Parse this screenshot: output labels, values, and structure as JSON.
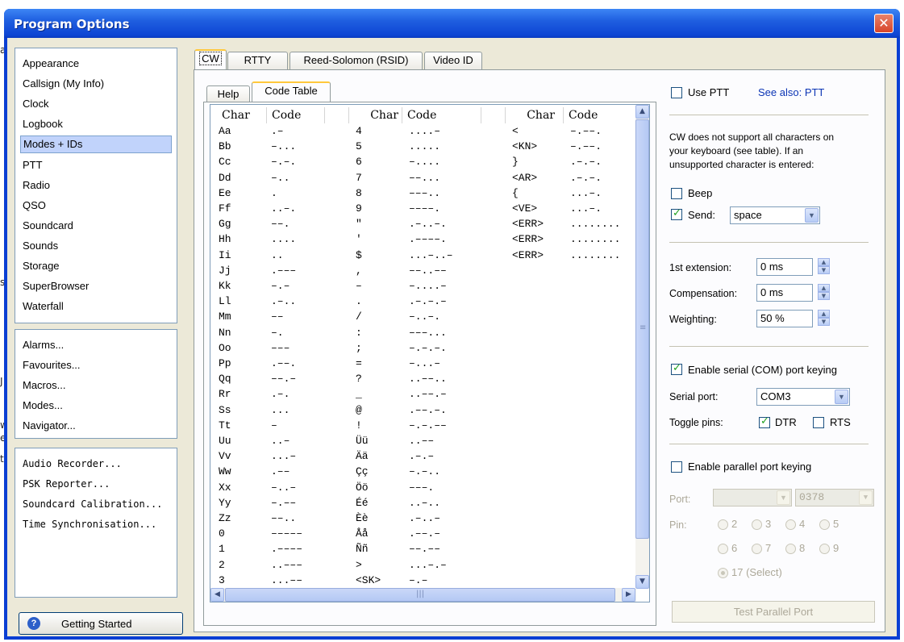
{
  "window": {
    "title": "Program Options",
    "close_glyph": "✕"
  },
  "nav": {
    "group1": [
      "Appearance",
      "Callsign (My Info)",
      "Clock",
      "Logbook",
      "Modes + IDs",
      "PTT",
      "Radio",
      "QSO",
      "Soundcard",
      "Sounds",
      "Storage",
      "SuperBrowser",
      "Waterfall"
    ],
    "selected": "Modes + IDs",
    "group2": [
      "Alarms...",
      "Favourites...",
      "Macros...",
      "Modes...",
      "Navigator..."
    ],
    "group3": [
      "Audio Recorder...",
      "PSK Reporter...",
      "Soundcard Calibration...",
      "Time Synchronisation..."
    ]
  },
  "getting_started": {
    "label": "Getting Started",
    "icon": "help-icon"
  },
  "tabs": [
    "CW",
    "RTTY",
    "Reed-Solomon (RSID)",
    "Video ID"
  ],
  "active_tab": "CW",
  "subtabs": [
    "Help",
    "Code Table"
  ],
  "active_subtab": "Code Table",
  "code_table": {
    "headers": [
      "Char",
      "Code",
      "Char",
      "Code",
      "Char",
      "Code"
    ],
    "col1": {
      "chars": [
        "Aa",
        "Bb",
        "Cc",
        "Dd",
        "Ee",
        "Ff",
        "Gg",
        "Hh",
        "Ii",
        "Jj",
        "Kk",
        "Ll",
        "Mm",
        "Nn",
        "Oo",
        "Pp",
        "Qq",
        "Rr",
        "Ss",
        "Tt",
        "Uu",
        "Vv",
        "Ww",
        "Xx",
        "Yy",
        "Zz",
        "0",
        "1",
        "2",
        "3"
      ],
      "codes": [
        ".–",
        "–...",
        "–.–.",
        "–..",
        ".",
        "..–.",
        "––.",
        "....",
        "..",
        ".–––",
        "–.–",
        ".–..",
        "––",
        "–.",
        "–––",
        ".––.",
        "––.–",
        ".–.",
        "...",
        "–",
        "..–",
        "...–",
        ".––",
        "–..–",
        "–.––",
        "––..",
        "–––––",
        ".––––",
        "..–––",
        "...––"
      ]
    },
    "col2": {
      "chars": [
        "4",
        "5",
        "6",
        "7",
        "8",
        "9",
        "\"",
        "'",
        "$",
        ",",
        "–",
        ".",
        "/",
        ":",
        ";",
        "=",
        "?",
        "_",
        "@",
        "!",
        "Üü",
        "Ää",
        "Çç",
        "Öö",
        "Éé",
        "Èè",
        "Åå",
        "Ññ",
        ">",
        "<SK>"
      ],
      "codes": [
        "....–",
        ".....",
        "–....",
        "––...",
        "–––..",
        "––––.",
        ".–..–.",
        ".––––.",
        "...–..–",
        "––..––",
        "–....–",
        ".–.–.–",
        "–..–.",
        "–––...",
        "–.–.–.",
        "–...–",
        "..––..",
        "..––.–",
        ".––.–.",
        "–.–.––",
        "..––",
        ".–.–",
        "–.–..",
        "–––.",
        "..–..",
        ".–..–",
        ".––.–",
        "––.––",
        "...–.–",
        "–.–"
      ]
    },
    "col3": {
      "chars": [
        "<",
        "<KN>",
        "}",
        "<AR>",
        "{",
        "<VE>",
        "<ERR>",
        "<ERR>",
        "<ERR>"
      ],
      "codes": [
        "–.––.",
        "–.––.",
        ".–.–.",
        ".–.–.",
        "...–.",
        "...–.",
        "........",
        "........",
        "........"
      ]
    }
  },
  "right": {
    "use_ptt": {
      "label": "Use PTT",
      "checked": false
    },
    "see_also": "See also: PTT",
    "cw_note": [
      "CW does not support all characters on",
      "your keyboard (see table). If an",
      "unsupported character is entered:"
    ],
    "beep": {
      "label": "Beep",
      "checked": false
    },
    "send": {
      "label": "Send:",
      "checked": true,
      "value": "space"
    },
    "first_extension": {
      "label": "1st extension:",
      "value": "0 ms"
    },
    "compensation": {
      "label": "Compensation:",
      "value": "0 ms"
    },
    "weighting": {
      "label": "Weighting:",
      "value": "50 %"
    },
    "serial_keying": {
      "label": "Enable serial (COM) port keying",
      "checked": true
    },
    "serial_port": {
      "label": "Serial port:",
      "value": "COM3"
    },
    "toggle_pins": {
      "label": "Toggle pins:",
      "dtr": "DTR",
      "dtr_checked": true,
      "rts": "RTS",
      "rts_checked": false
    },
    "parallel_keying": {
      "label": "Enable parallel port keying",
      "checked": false
    },
    "port": {
      "label": "Port:",
      "value1": "",
      "value2": "0378"
    },
    "pin": {
      "label": "Pin:",
      "options": [
        "2",
        "3",
        "4",
        "5",
        "6",
        "7",
        "8",
        "9",
        "17 (Select)"
      ],
      "selected": "17 (Select)"
    },
    "test_button": "Test Parallel Port"
  },
  "background": [
    "a",
    "s",
    "J",
    "w",
    "e",
    "t"
  ]
}
